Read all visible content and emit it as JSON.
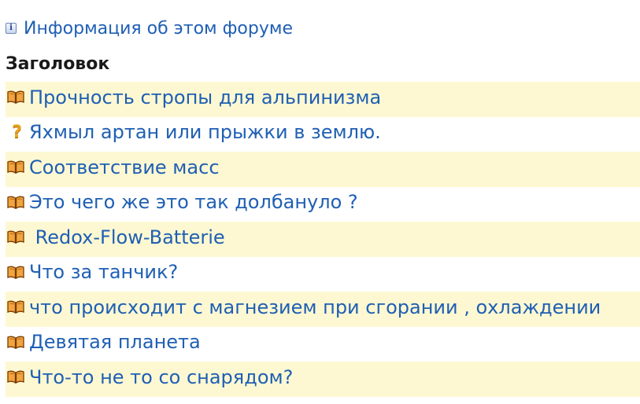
{
  "forum_info": {
    "icon": "info-icon",
    "link_text": "Информация об этом форуме"
  },
  "table": {
    "header": "Заголовок"
  },
  "topics": [
    {
      "icon": "open-book-icon",
      "title": "Прочность стропы для альпинизма"
    },
    {
      "icon": "question-icon",
      "title": "Яхмыл артан или прыжки в землю."
    },
    {
      "icon": "open-book-icon",
      "title": "Соответствие масс"
    },
    {
      "icon": "open-book-icon",
      "title": "Это чего же это так долбануло ?"
    },
    {
      "icon": "open-book-icon",
      "title": " Redox-Flow-Batterie"
    },
    {
      "icon": "open-book-icon",
      "title": "Что за танчик?"
    },
    {
      "icon": "open-book-icon",
      "title": "что происходит с магнезием при сгорании , охлаждении"
    },
    {
      "icon": "open-book-icon",
      "title": "Девятая планета"
    },
    {
      "icon": "open-book-icon",
      "title": "Что-то не то со снарядом?"
    }
  ],
  "colors": {
    "link": "#1f5fb4",
    "row_highlight": "#fdf8d2",
    "book_icon": "#d98a1c",
    "question_icon": "#e8a31a"
  }
}
